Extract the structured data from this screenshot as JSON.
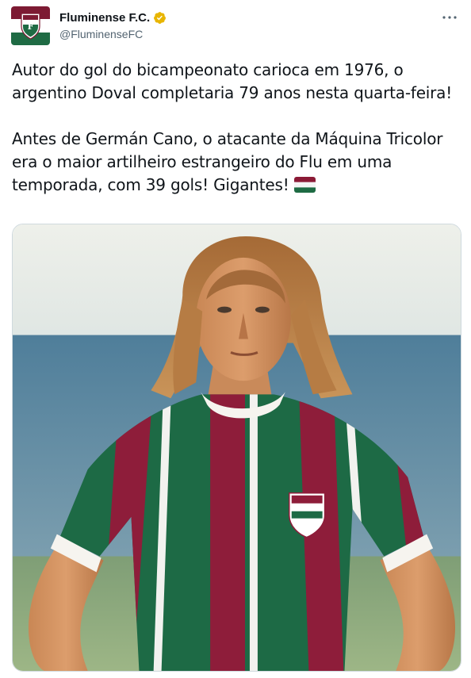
{
  "author": {
    "display_name": "Fluminense F.C.",
    "handle": "@FluminenseFC",
    "verified_badge": "verified-badge-gold",
    "avatar_icon": "club-crest-icon"
  },
  "menu": {
    "icon": "more-options-icon"
  },
  "tweet": {
    "paragraph_1": "Autor do gol do bicampeonato carioca em 1976, o argentino Doval completaria 79 anos nesta quarta-feira!",
    "paragraph_2": "Antes de Germán Cano, o atacante da Máquina Tricolor era o maior artilheiro estrangeiro do Flu em uma temporada, com 39 gols! Gigantes!",
    "emoji": "tricolor-flag-emoji"
  },
  "media": {
    "type": "photo",
    "subject": "player-in-striped-jersey"
  },
  "colors": {
    "maroon": "#8b1a36",
    "green": "#1e6b43",
    "white": "#ffffff",
    "gold_badge": "#e8b500",
    "handle_gray": "#536471"
  }
}
